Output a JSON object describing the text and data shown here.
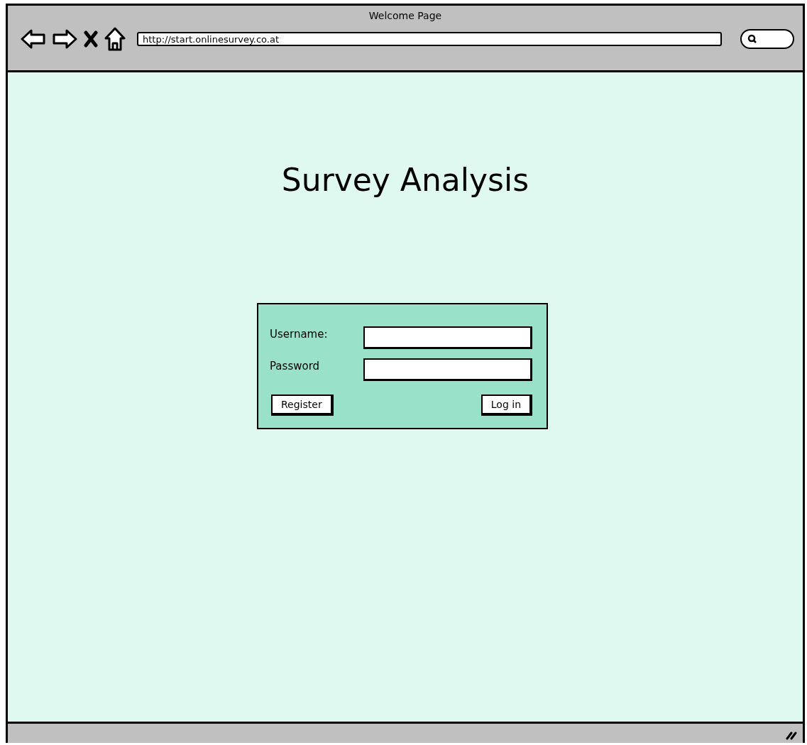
{
  "window": {
    "title": "Welcome Page"
  },
  "address_bar": {
    "value": "http://start.onlinesurvey.co.at"
  },
  "page": {
    "heading": "Survey Analysis"
  },
  "login_form": {
    "fields": [
      {
        "label": "Username:"
      },
      {
        "label": "Password"
      }
    ],
    "buttons": [
      {
        "label": "Register"
      },
      {
        "label": "Log in"
      }
    ]
  }
}
